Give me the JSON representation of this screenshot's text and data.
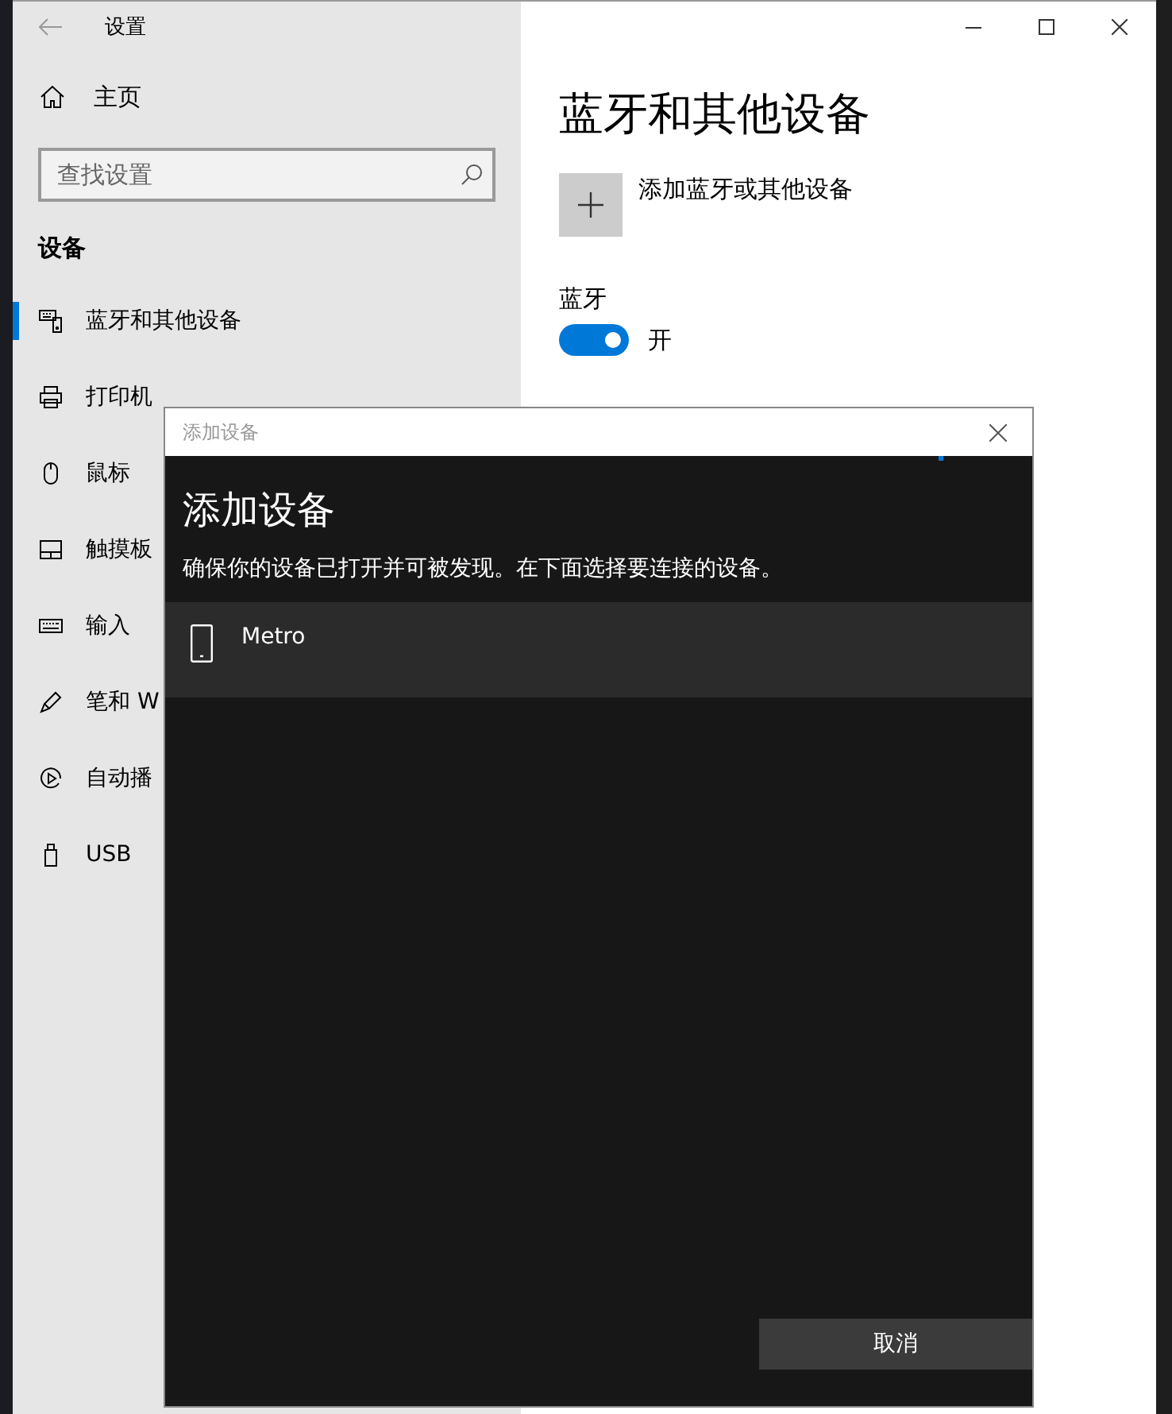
{
  "window": {
    "title": "设置"
  },
  "sidebar": {
    "home": "主页",
    "search": {
      "placeholder": "查找设置"
    },
    "section": "设备",
    "items": [
      {
        "label": "蓝牙和其他设备",
        "selected": true
      },
      {
        "label": "打印机",
        "selected": false
      },
      {
        "label": "鼠标",
        "selected": false
      },
      {
        "label": "触摸板",
        "selected": false
      },
      {
        "label": "输入",
        "selected": false
      },
      {
        "label": "笔和 W",
        "selected": false
      },
      {
        "label": "自动播",
        "selected": false
      },
      {
        "label": "USB",
        "selected": false
      }
    ]
  },
  "main": {
    "heading": "蓝牙和其他设备",
    "add_button": "添加蓝牙或其他设备",
    "bluetooth": {
      "label": "蓝牙",
      "on": true,
      "state_text": "开"
    }
  },
  "dialog": {
    "title": "添加设备",
    "heading": "添加设备",
    "description": "确保你的设备已打开并可被发现。在下面选择要连接的设备。",
    "devices": [
      {
        "name": "Metro",
        "selected": true
      }
    ],
    "cancel": "取消"
  }
}
